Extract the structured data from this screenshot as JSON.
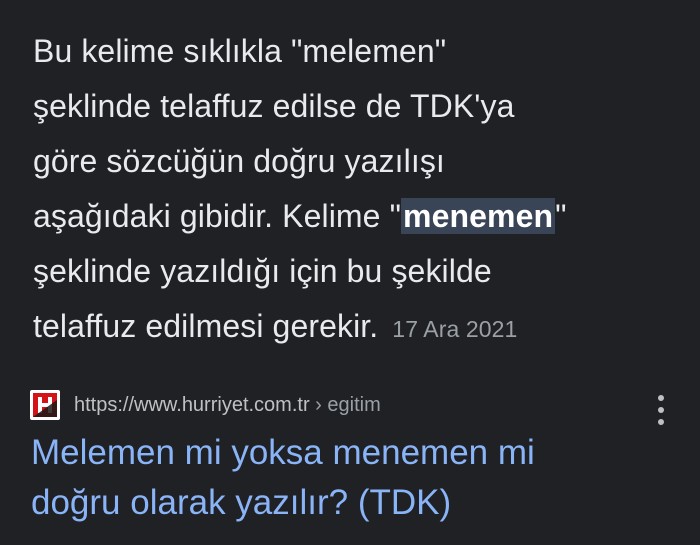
{
  "snippet": {
    "lines": [
      "Bu kelime sıklıkla \"melemen\"",
      "şeklinde telaffuz edilse de TDK'ya",
      "göre sözcüğün doğru yazılışı",
      "aşağıdaki gibidir. Kelime \"",
      "şeklinde yazıldığı için bu şekilde",
      "telaffuz edilmesi gerekir."
    ],
    "highlight": "menemen",
    "after_highlight": "\"",
    "date": "17 Ara 2021"
  },
  "result": {
    "favicon_name": "hurriyet-logo-icon",
    "url": "https://www.hurriyet.com.tr",
    "breadcrumb": " › egitim",
    "title_lines": [
      "Melemen mi yoksa menemen mi",
      "doğru olarak yazılır? (TDK)"
    ]
  },
  "colors": {
    "background": "#202124",
    "text": "#e8eaed",
    "link": "#8ab4f8",
    "highlight_bg": "#394457",
    "muted": "#9aa0a6"
  }
}
